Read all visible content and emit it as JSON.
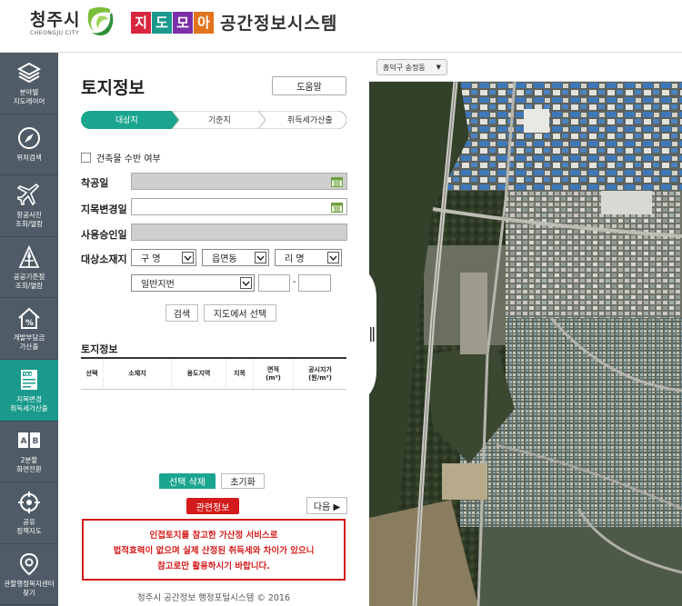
{
  "header": {
    "city_name": "청주시",
    "city_name_en": "CHEONGJU CITY",
    "brand_chars": [
      "지",
      "도",
      "모",
      "아"
    ],
    "brand_colors": [
      "#d7263d",
      "#1a9a8c",
      "#7b2fa8",
      "#e2731d"
    ],
    "system_title": "공간정보시스템"
  },
  "leftnav": {
    "items": [
      {
        "label": "분야별\n지도레이어",
        "icon": "layers-icon"
      },
      {
        "label": "위치검색",
        "icon": "compass-icon"
      },
      {
        "label": "항공사진\n조회/열람",
        "icon": "airplane-icon"
      },
      {
        "label": "공공기준점\n조회/열람",
        "icon": "benchmark-icon"
      },
      {
        "label": "개발부담금\n가산출",
        "icon": "house-percent-icon"
      },
      {
        "label": "지목변경\n취득세가산출",
        "icon": "tax-document-icon",
        "active": true
      },
      {
        "label": "2분할\n화면전환",
        "icon": "split-screen-icon"
      },
      {
        "label": "공유\n정책지도",
        "icon": "crosshair-icon"
      },
      {
        "label": "관할행정복지센터\n찾기",
        "icon": "location-pin-icon"
      }
    ]
  },
  "panel": {
    "title": "토지정보",
    "help_button": "도움말",
    "steps": [
      "대상지",
      "기준지",
      "취득세가산출"
    ],
    "checkbox_label": "건축물 수반 여부",
    "fields": {
      "start_date": "착공일",
      "change_date": "지목변경일",
      "approval_date": "사용승인일",
      "location": "대상소재지"
    },
    "selects": {
      "gu": "구 명",
      "dong": "읍면동",
      "ri": "리 명",
      "lot_type": "일반지번"
    },
    "lot_separator": "-",
    "search_button": "검색",
    "map_select_button": "지도에서 선택",
    "section_title": "토지정보",
    "columns": [
      "선택",
      "소재지",
      "용도지역",
      "지목",
      "면적\n(m²)",
      "공시지가\n(원/m²)"
    ],
    "delete_button": "선택 삭제",
    "reset_button": "초기화",
    "related_button": "관련정보",
    "next_button": "다음 ▶",
    "notice_lines": [
      "인접토지를 참고한 가산정 서비스로",
      "법적효력이 없으며 실제 산정된 취득세와 차이가 있으니",
      "참고로만 활용하시기 바랍니다."
    ],
    "footer": "청주시 공간정보 행정포털시스템 © 2016"
  },
  "map": {
    "district_select": "흥덕구 송정동"
  },
  "colors": {
    "nav_bg": "#4f5b66",
    "nav_active": "#1a9a8c",
    "step_active": "#1aa58f",
    "danger": "#d41b1b"
  }
}
